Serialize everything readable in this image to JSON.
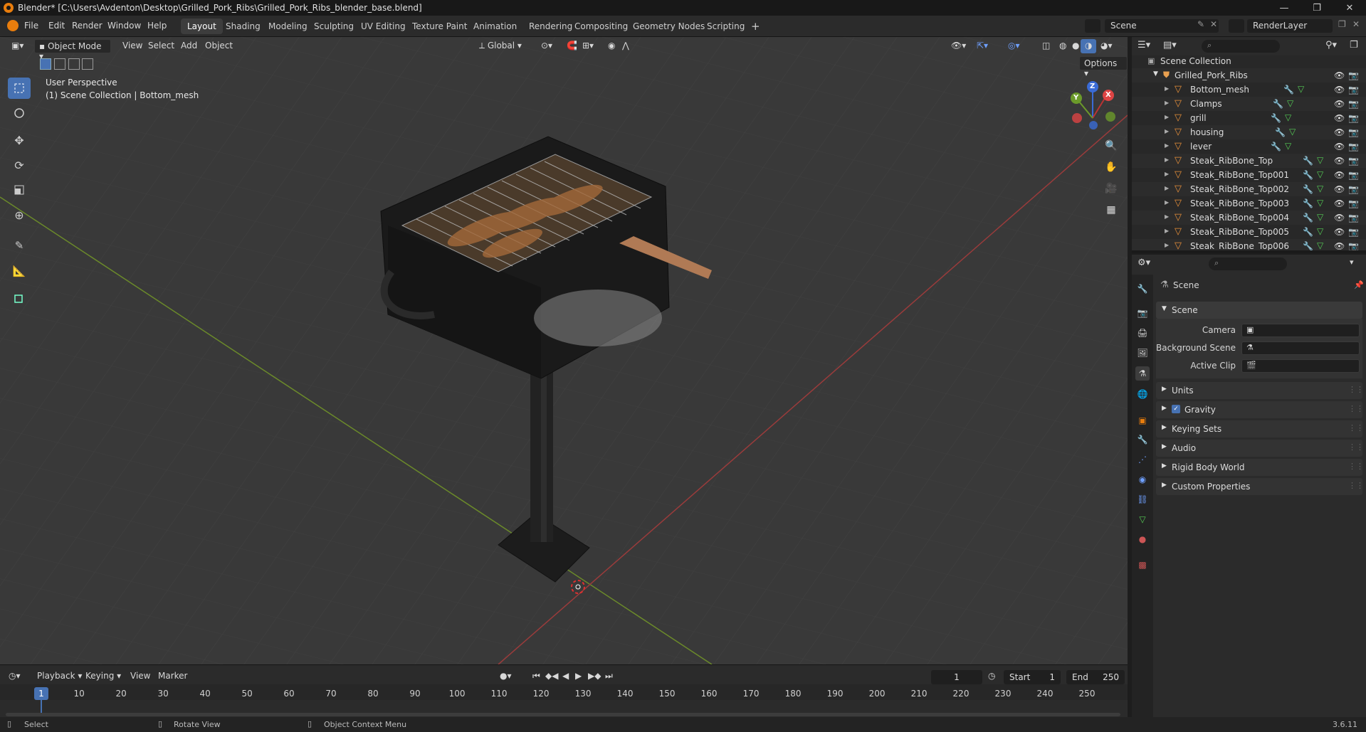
{
  "window": {
    "title": "Blender* [C:\\Users\\Avdenton\\Desktop\\Grilled_Pork_Ribs\\Grilled_Pork_Ribs_blender_base.blend]"
  },
  "menu": [
    "File",
    "Edit",
    "Render",
    "Window",
    "Help"
  ],
  "workspaces": [
    "Layout",
    "Shading",
    "Modeling",
    "Sculpting",
    "UV Editing",
    "Texture Paint",
    "Animation",
    "Rendering",
    "Compositing",
    "Geometry Nodes",
    "Scripting"
  ],
  "active_workspace": "Layout",
  "scene_selector": {
    "scene": "Scene",
    "view_layer": "RenderLayer"
  },
  "viewport": {
    "mode": "Object Mode",
    "menus": [
      "View",
      "Select",
      "Add",
      "Object"
    ],
    "orientation": "Global",
    "options": "Options",
    "overlay_title": "User Perspective",
    "overlay_subtitle": "(1) Scene Collection | Bottom_mesh",
    "gizmo": {
      "x": "X",
      "y": "Y",
      "z": "Z"
    }
  },
  "outliner": {
    "root": "Scene Collection",
    "collection": "Grilled_Pork_Ribs",
    "objects": [
      "Bottom_mesh",
      "Clamps",
      "grill",
      "housing",
      "lever",
      "Steak_RibBone_Top",
      "Steak_RibBone_Top001",
      "Steak_RibBone_Top002",
      "Steak_RibBone_Top003",
      "Steak_RibBone_Top004",
      "Steak_RibBone_Top005",
      "Steak_RibBone_Top006"
    ]
  },
  "properties": {
    "context": "Scene",
    "section": "Scene",
    "fields": [
      {
        "label": "Camera"
      },
      {
        "label": "Background Scene"
      },
      {
        "label": "Active Clip"
      }
    ],
    "panels": [
      "Units",
      "Gravity",
      "Keying Sets",
      "Audio",
      "Rigid Body World",
      "Custom Properties"
    ],
    "gravity_checked": true
  },
  "timeline": {
    "menus": [
      "Playback",
      "Keying",
      "View",
      "Marker"
    ],
    "current_frame": "1",
    "start_label": "Start",
    "start": "1",
    "end_label": "End",
    "end": "250",
    "ticks": [
      "1",
      "10",
      "20",
      "30",
      "40",
      "50",
      "60",
      "70",
      "80",
      "90",
      "100",
      "110",
      "120",
      "130",
      "140",
      "150",
      "160",
      "170",
      "180",
      "190",
      "200",
      "210",
      "220",
      "230",
      "240",
      "250"
    ]
  },
  "statusbar": {
    "left": "Select",
    "middle": "Rotate View",
    "right": "Object Context Menu",
    "version": "3.6.11"
  },
  "colors": {
    "accent": "#4772b3",
    "orange": "#e87d0d",
    "x_axis": "#9a3b3b",
    "y_axis": "#6d8f2a",
    "selected_tool": "#4772b3"
  }
}
